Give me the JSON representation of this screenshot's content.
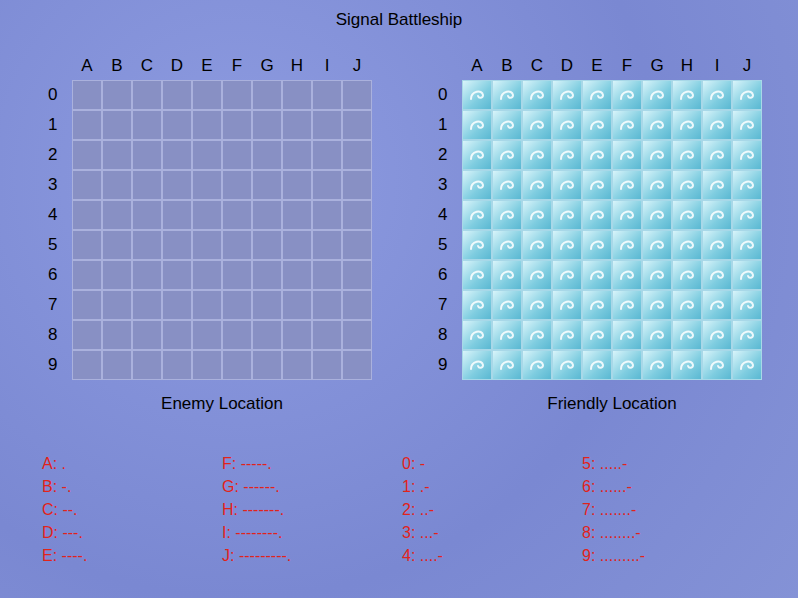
{
  "window": {
    "title": "Signal Battleship"
  },
  "grids": [
    {
      "kind": "enemy",
      "label": "Enemy Location",
      "columns": [
        "A",
        "B",
        "C",
        "D",
        "E",
        "F",
        "G",
        "H",
        "I",
        "J"
      ],
      "rows": [
        "0",
        "1",
        "2",
        "3",
        "4",
        "5",
        "6",
        "7",
        "8",
        "9"
      ]
    },
    {
      "kind": "friendly",
      "label": "Friendly Location",
      "columns": [
        "A",
        "B",
        "C",
        "D",
        "E",
        "F",
        "G",
        "H",
        "I",
        "J"
      ],
      "rows": [
        "0",
        "1",
        "2",
        "3",
        "4",
        "5",
        "6",
        "7",
        "8",
        "9"
      ]
    }
  ],
  "legend": [
    [
      "A: .",
      "B: -.",
      "C: --.",
      "D: ---.",
      "E: ----."
    ],
    [
      "F: -----.",
      "G: ------.",
      "H: -------.",
      "I: --------.",
      "J: ---------."
    ],
    [
      "0: -",
      "1: .-",
      "2: ..-",
      "3: ...-",
      "4: ....-"
    ],
    [
      "5: .....-",
      "6: ......-",
      "7: .......-",
      "8: ........-",
      "9: .........-"
    ]
  ]
}
